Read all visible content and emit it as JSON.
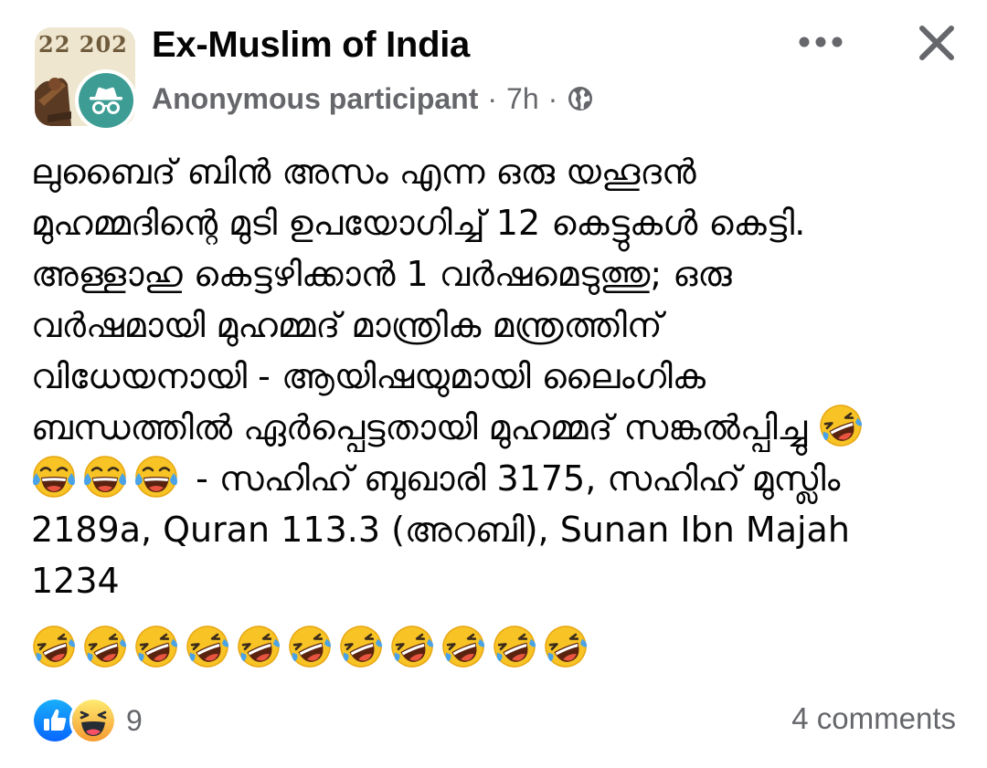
{
  "header": {
    "group_photo_text": "22 202",
    "group_name": "Ex-Muslim of India",
    "author": "Anonymous participant",
    "separator": "·",
    "time": "7h",
    "audience_icon": "globe-icon",
    "more_icon": "more-horizontal-icon",
    "close_icon": "close-icon"
  },
  "post": {
    "lines": [
      "ലുബൈദ് ബിൻ അസം എന്ന ഒരു യഹൂദൻ",
      "മുഹമ്മദിന്റെ മുടി ഉപയോഗിച്ച് 12 കെട്ടുകൾ കെട്ടി.",
      "അള്ളാഹു കെട്ടഴിക്കാൻ 1 വർഷമെടുത്തു; ഒരു",
      "വർഷമായി മുഹമ്മദ് മാന്ത്രിക മന്ത്രത്തിന്",
      "വിധേയനായി - ആയിഷയുമായി ലൈംഗിക",
      "ബന്ധത്തിൽ ഏർപ്പെട്ടതായി മുഹമ്മദ് സങ്കൽപ്പിച്ചു",
      " - സഹിഹ് ബുഖാരി 3175, സഹിഹ് മുസ്ലിം",
      "2189a, Quran 113.3 (അറബി), Sunan Ibn Majah",
      "1234"
    ],
    "emoji_rolling": "🤣",
    "emoji_tears": "😂",
    "trailing_rolling_count": 11
  },
  "footer": {
    "reaction_icons": [
      "like-icon",
      "haha-icon"
    ],
    "reaction_count": "9",
    "comments": "4 comments"
  },
  "colors": {
    "text": "#050505",
    "secondary": "#65676b",
    "anon_avatar": "#3d9d94",
    "like_blue": "#1877f2",
    "emoji_yellow": "#f7b928"
  }
}
